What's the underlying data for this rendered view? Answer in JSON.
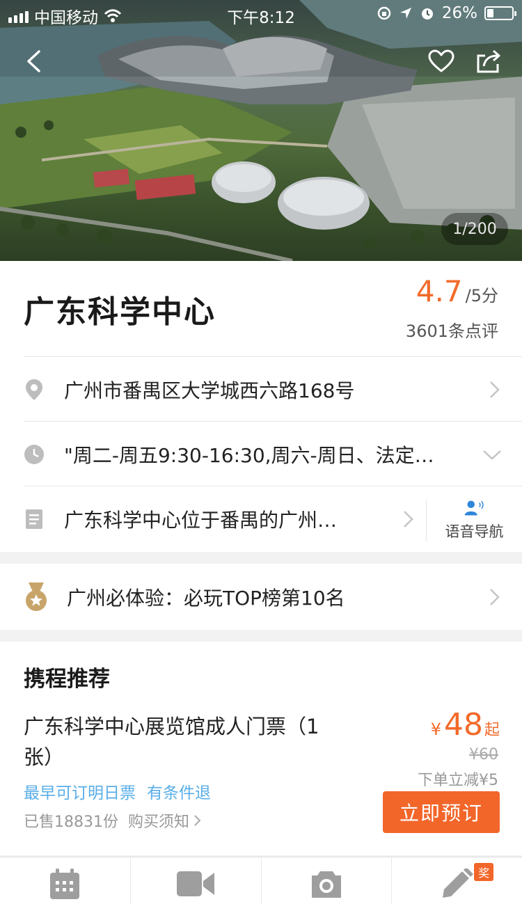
{
  "status_bar": {
    "carrier": "中国移动",
    "time": "下午8:12",
    "battery": "26%",
    "battery_level": 0.26
  },
  "hero": {
    "counter": "1/200",
    "icons": [
      "back-arrow-icon",
      "heart-icon",
      "share-icon"
    ]
  },
  "poi": {
    "name": "广东科学中心",
    "score": "4.7",
    "score_suffix": "/5分",
    "reviews": "3601条点评"
  },
  "info_rows": {
    "address": "广州市番禺区大学城西六路168号",
    "hours": "\"周二-周五9:30-16:30,周六-周日、法定…",
    "intro": "广东科学中心位于番禺的广州…",
    "voice_nav": "语音导航"
  },
  "ranking": {
    "text": "广州必体验：必玩TOP榜第10名"
  },
  "recommend": {
    "section_title": "携程推荐",
    "product_name": "广东科学中心展览馆成人门票（1张）",
    "tags": [
      "最早可订明日票",
      "有条件退"
    ],
    "sold": "已售18831份",
    "notice": "购买须知",
    "currency": "¥",
    "price": "48",
    "price_suffix": "起",
    "original_price": "¥60",
    "discount": "下单立减¥5",
    "book_button": "立即预订"
  },
  "tab_bar": {
    "tabs": [
      "calendar-icon",
      "video-camera-icon",
      "camera-icon",
      "pencil-icon"
    ],
    "badge": "奖"
  },
  "colors": {
    "accent_orange": "#f26a2a",
    "tag_blue": "#59aee8",
    "icon_gray": "#bdbdbd",
    "medal_gold": "#c9a46a"
  }
}
